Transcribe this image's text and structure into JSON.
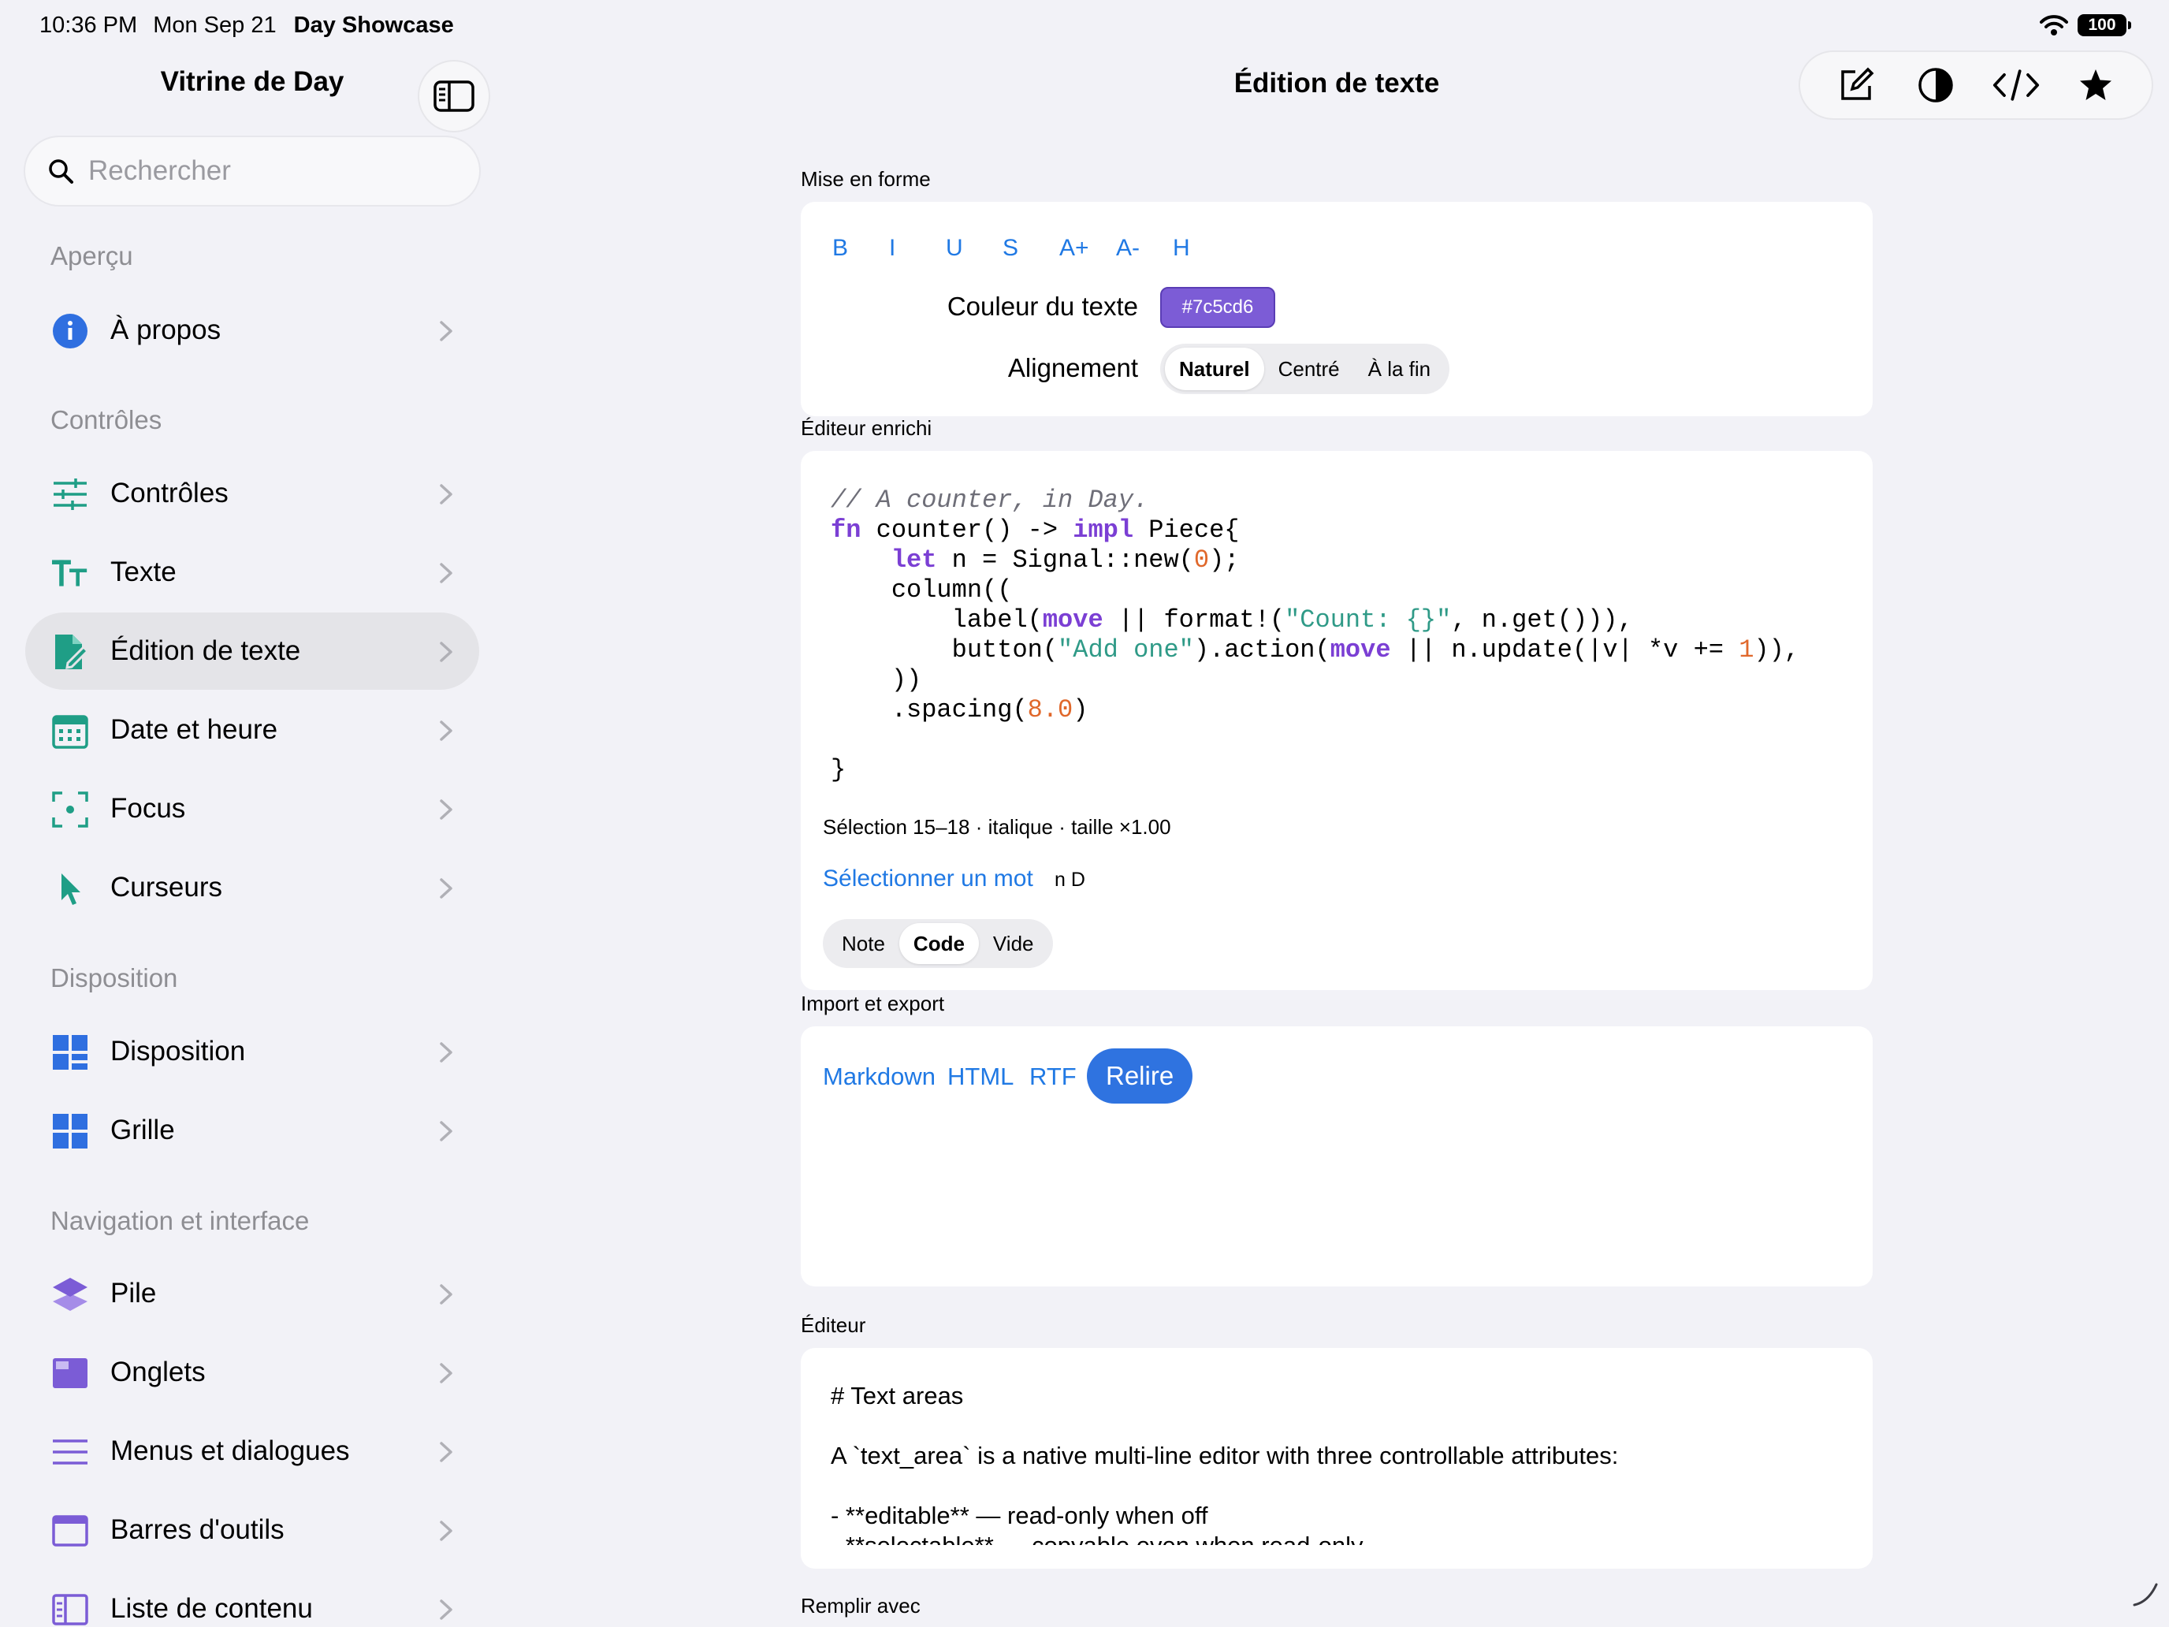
{
  "status_bar": {
    "time": "10:36 PM",
    "date": "Mon Sep 21",
    "app_name": "Day Showcase",
    "battery": "100"
  },
  "sidebar": {
    "title": "Vitrine de Day",
    "search_placeholder": "Rechercher",
    "sections": [
      {
        "header": "Aperçu",
        "items": [
          {
            "label": "À propos",
            "icon": "info-icon"
          }
        ]
      },
      {
        "header": "Contrôles",
        "items": [
          {
            "label": "Contrôles",
            "icon": "sliders-icon"
          },
          {
            "label": "Texte",
            "icon": "text-size-icon"
          },
          {
            "label": "Édition de texte",
            "icon": "doc-edit-icon",
            "active": true
          },
          {
            "label": "Date et heure",
            "icon": "calendar-icon"
          },
          {
            "label": "Focus",
            "icon": "focus-icon"
          },
          {
            "label": "Curseurs",
            "icon": "cursor-icon"
          }
        ]
      },
      {
        "header": "Disposition",
        "items": [
          {
            "label": "Disposition",
            "icon": "layout-icon"
          },
          {
            "label": "Grille",
            "icon": "grid-icon"
          }
        ]
      },
      {
        "header": "Navigation et interface",
        "items": [
          {
            "label": "Pile",
            "icon": "stack-icon"
          },
          {
            "label": "Onglets",
            "icon": "tabs-icon"
          },
          {
            "label": "Menus et dialogues",
            "icon": "menu-icon"
          },
          {
            "label": "Barres d'outils",
            "icon": "toolbar-icon"
          },
          {
            "label": "Liste de contenu",
            "icon": "list-content-icon"
          }
        ]
      }
    ]
  },
  "main": {
    "title": "Édition de texte",
    "formatting": {
      "label": "Mise en forme",
      "buttons": [
        "B",
        "I",
        "U",
        "S",
        "A+",
        "A-",
        "H"
      ],
      "text_color_label": "Couleur du texte",
      "text_color_value": "#7c5cd6",
      "alignment_label": "Alignement",
      "alignment_options": [
        "Naturel",
        "Centré",
        "À la fin"
      ],
      "alignment_selected": "Naturel"
    },
    "rich_editor": {
      "label": "Éditeur enrichi",
      "selection_info": "Sélection 15–18 · italique · taille ×1.00",
      "select_word_link": "Sélectionner un mot",
      "select_word_extra": "n D",
      "modes": [
        "Note",
        "Code",
        "Vide"
      ],
      "mode_selected": "Code"
    },
    "import_export": {
      "label": "Import et export",
      "links": [
        "Markdown",
        "HTML",
        "RTF"
      ],
      "reload_label": "Relire"
    },
    "editor": {
      "label": "Éditeur",
      "lines": [
        "# Text areas",
        "",
        "A `text_area` is a native multi-line editor with three controllable attributes:",
        "",
        "- **editable** — read-only when off",
        "- **selectable** — copyable even when read-only"
      ]
    },
    "fill_with": {
      "label": "Remplir avec"
    }
  },
  "colors": {
    "accent": "#2079e4",
    "sidebar_icon_teal": "#1f9e86",
    "sidebar_icon_blue": "#2f6fe0",
    "sidebar_icon_purple": "#7b5cd6",
    "reload_button": "#2f73e0",
    "code_keyword": "#7b3fd4",
    "code_string": "#2f9a87",
    "code_number": "#e0682b"
  }
}
